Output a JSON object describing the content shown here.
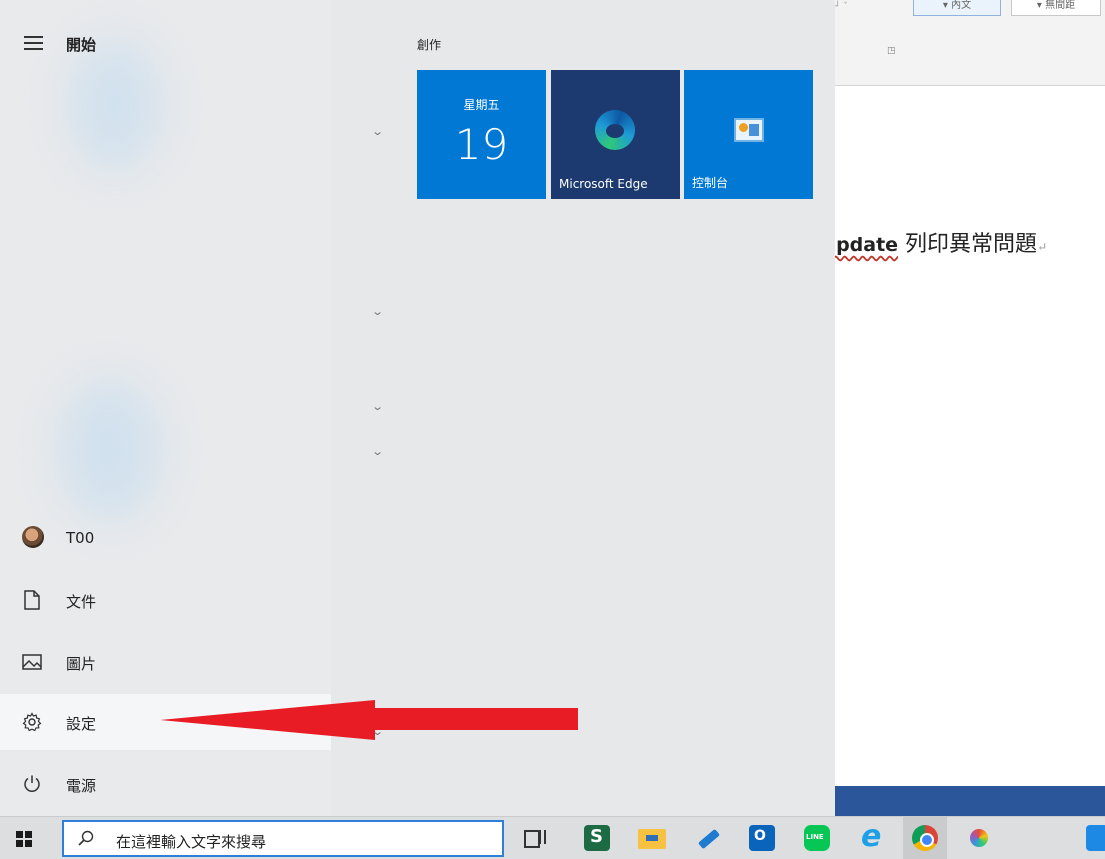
{
  "start_menu": {
    "title": "開始",
    "group_header": "創作",
    "nav": [
      {
        "label": "T00",
        "icon": "user-avatar"
      },
      {
        "label": "文件",
        "icon": "document-icon"
      },
      {
        "label": "圖片",
        "icon": "pictures-icon"
      },
      {
        "label": "設定",
        "icon": "gear-icon"
      },
      {
        "label": "電源",
        "icon": "power-icon"
      }
    ],
    "tiles": {
      "calendar": {
        "day": "星期五",
        "date": "19"
      },
      "edge": {
        "label": "Microsoft Edge"
      },
      "control_panel": {
        "label": "控制台"
      }
    }
  },
  "word_doc": {
    "heading_latin": "Jpdate",
    "heading_cjk": " 列印異常問題",
    "heading_mark": "↵",
    "ribbon_button_1": "▾ 內文",
    "ribbon_button_2": "▾ 無間距"
  },
  "taskbar": {
    "search_placeholder": "在這裡輸入文字來搜尋",
    "pinned_icons": [
      "task-view-icon",
      "green-s-app-icon",
      "file-explorer-icon",
      "pen-app-icon",
      "outlook-icon",
      "line-icon",
      "internet-explorer-icon",
      "chrome-icon",
      "paint-app-icon",
      "app-icon"
    ]
  },
  "colors": {
    "tile_blue": "#0078d4",
    "edge_tile": "#1c3a6f",
    "annotation_red": "#e81c24",
    "word_blue": "#2b579a",
    "search_border": "#2f7fd8"
  }
}
